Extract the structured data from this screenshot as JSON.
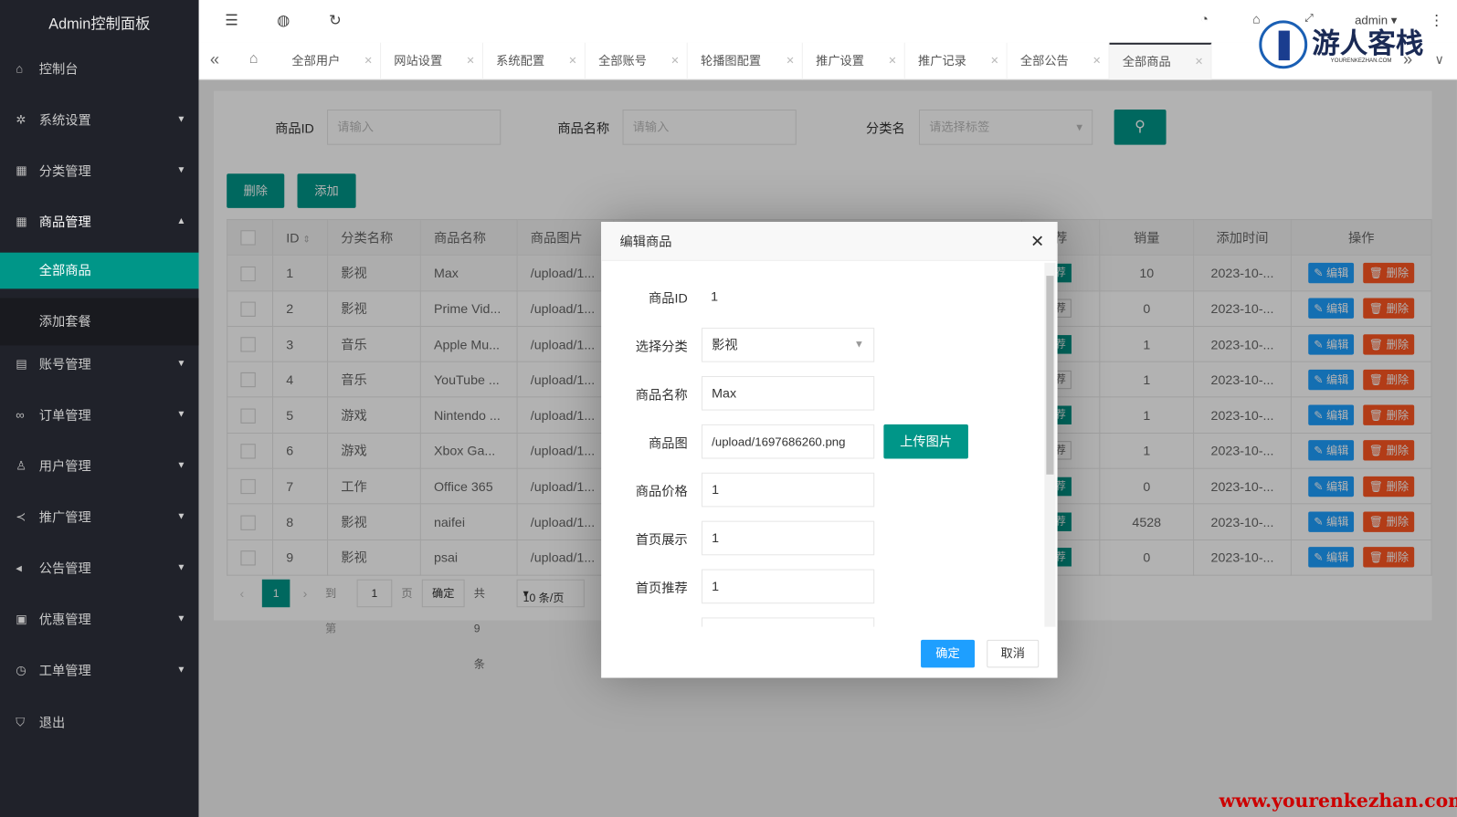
{
  "sidebar": {
    "title": "Admin控制面板",
    "items": [
      {
        "label": "控制台",
        "icon": "home-icon"
      },
      {
        "label": "系统设置",
        "icon": "gear-icon"
      },
      {
        "label": "分类管理",
        "icon": "apps-icon"
      },
      {
        "label": "商品管理",
        "icon": "apps-icon"
      },
      {
        "label": "账号管理",
        "icon": "table-icon"
      },
      {
        "label": "订单管理",
        "icon": "link-icon"
      },
      {
        "label": "用户管理",
        "icon": "user-icon"
      },
      {
        "label": "推广管理",
        "icon": "share-icon"
      },
      {
        "label": "公告管理",
        "icon": "speaker-icon"
      },
      {
        "label": "优惠管理",
        "icon": "calendar-icon"
      },
      {
        "label": "工单管理",
        "icon": "clock-icon"
      },
      {
        "label": "退出",
        "icon": "shield-icon"
      }
    ],
    "sub": [
      "全部商品",
      "添加套餐"
    ]
  },
  "header": {
    "user": "admin"
  },
  "tabs": [
    "全部用户",
    "网站设置",
    "系统配置",
    "全部账号",
    "轮播图配置",
    "推广设置",
    "推广记录",
    "全部公告",
    "全部商品"
  ],
  "search": {
    "id_label": "商品ID",
    "id_placeholder": "请输入",
    "name_label": "商品名称",
    "name_placeholder": "请输入",
    "cat_label": "分类名",
    "cat_placeholder": "请选择标签"
  },
  "toolbar": {
    "delete": "删除",
    "add": "添加"
  },
  "table": {
    "headers": [
      "ID",
      "分类名称",
      "商品名称",
      "商品图片",
      "荐",
      "销量",
      "添加时间",
      "操作"
    ],
    "edit": "编辑",
    "del": "删除",
    "rows": [
      {
        "id": "1",
        "cat": "影视",
        "name": "Max",
        "img": "/upload/1...",
        "rec": true,
        "sales": "10",
        "time": "2023-10-..."
      },
      {
        "id": "2",
        "cat": "影视",
        "name": "Prime Vid...",
        "img": "/upload/1...",
        "rec": false,
        "sales": "0",
        "time": "2023-10-..."
      },
      {
        "id": "3",
        "cat": "音乐",
        "name": "Apple Mu...",
        "img": "/upload/1...",
        "rec": true,
        "sales": "1",
        "time": "2023-10-..."
      },
      {
        "id": "4",
        "cat": "音乐",
        "name": "YouTube ...",
        "img": "/upload/1...",
        "rec": false,
        "sales": "1",
        "time": "2023-10-..."
      },
      {
        "id": "5",
        "cat": "游戏",
        "name": "Nintendo ...",
        "img": "/upload/1...",
        "rec": true,
        "sales": "1",
        "time": "2023-10-..."
      },
      {
        "id": "6",
        "cat": "游戏",
        "name": "Xbox Ga...",
        "img": "/upload/1...",
        "rec": false,
        "sales": "1",
        "time": "2023-10-..."
      },
      {
        "id": "7",
        "cat": "工作",
        "name": "Office 365",
        "img": "/upload/1...",
        "rec": true,
        "sales": "0",
        "time": "2023-10-..."
      },
      {
        "id": "8",
        "cat": "影视",
        "name": "naifei",
        "img": "/upload/1...",
        "rec": true,
        "sales": "4528",
        "time": "2023-10-..."
      },
      {
        "id": "9",
        "cat": "影视",
        "name": "psai",
        "img": "/upload/1...",
        "rec": true,
        "sales": "0",
        "time": "2023-10-..."
      }
    ]
  },
  "pager": {
    "current": "1",
    "goto": "到第",
    "page_value": "1",
    "page_unit": "页",
    "confirm": "确定",
    "total": "共 9 条",
    "per_page": "10 条/页"
  },
  "modal": {
    "title": "编辑商品",
    "id_label": "商品ID",
    "id_value": "1",
    "cat_label": "选择分类",
    "cat_value": "影视",
    "name_label": "商品名称",
    "name_value": "Max",
    "img_label": "商品图",
    "img_value": "/upload/1697686260.png",
    "upload": "上传图片",
    "price_label": "商品价格",
    "price_value": "1",
    "show_label": "首页展示",
    "show_value": "1",
    "rec_label": "首页推荐",
    "rec_value": "1",
    "ok": "确定",
    "cancel": "取消"
  },
  "watermark": {
    "logo": "游人客栈",
    "logo_sub": "YOURENKEZHAN.COM",
    "url": "www.yourenkezhan.com"
  },
  "colors": {
    "accent": "#009688",
    "blue": "#1e9fff",
    "danger": "#ff5722",
    "sidebar": "#20222a"
  }
}
